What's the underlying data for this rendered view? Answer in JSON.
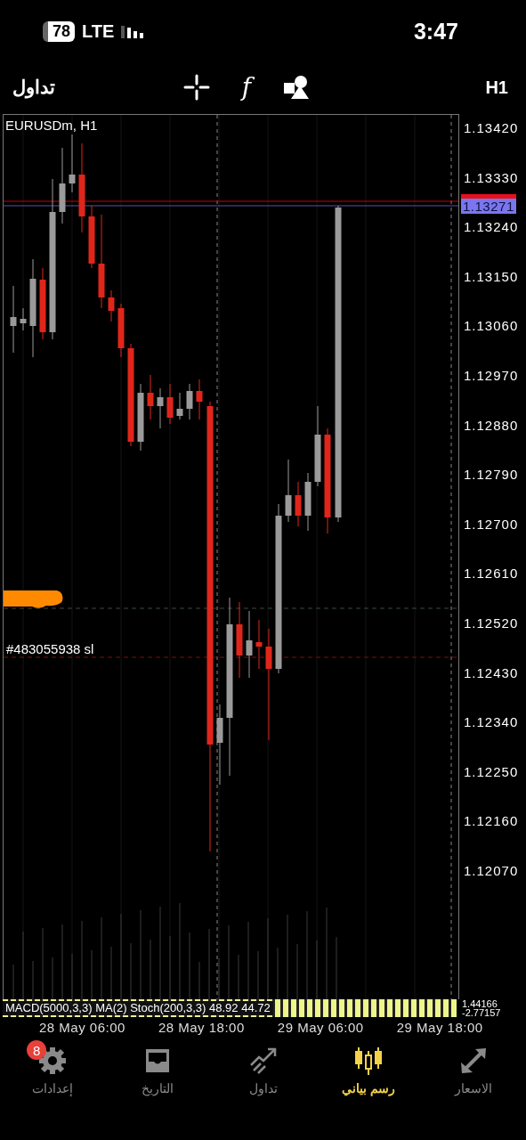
{
  "status_bar": {
    "battery": "78",
    "network": "LTE",
    "time": "3:47"
  },
  "toolbar": {
    "title": "تداول",
    "indicator_symbol": "f",
    "timeframe": "H1"
  },
  "chart": {
    "symbol_label": "EURUSDm, H1",
    "price_ticks": [
      "1.13420",
      "1.13330",
      "1.13240",
      "1.13150",
      "1.13060",
      "1.12970",
      "1.12880",
      "1.12790",
      "1.12700",
      "1.12610",
      "1.12520",
      "1.12430",
      "1.12340",
      "1.12250",
      "1.12160",
      "1.12070"
    ],
    "current_price": "1.13271",
    "order_label": "#483055938 sl",
    "indicator_label": "MACD(5000,3,3) MA(2) Stoch(200,3,3) 48.92 44.72",
    "indicator_values": [
      "1.44166",
      "-2.77157"
    ],
    "time_labels": [
      "28 May 06:00",
      "28 May 18:00",
      "29 May 06:00",
      "29 May 18:00"
    ]
  },
  "tabs": [
    {
      "label": "الاسعار",
      "kind": "quotes",
      "selected": false
    },
    {
      "label": "رسم بياني",
      "kind": "chart",
      "selected": true
    },
    {
      "label": "تداول",
      "kind": "trade",
      "selected": false
    },
    {
      "label": "التاريخ",
      "kind": "history",
      "selected": false
    },
    {
      "label": "إعدادات",
      "kind": "settings",
      "selected": false,
      "badge": "8"
    }
  ]
}
